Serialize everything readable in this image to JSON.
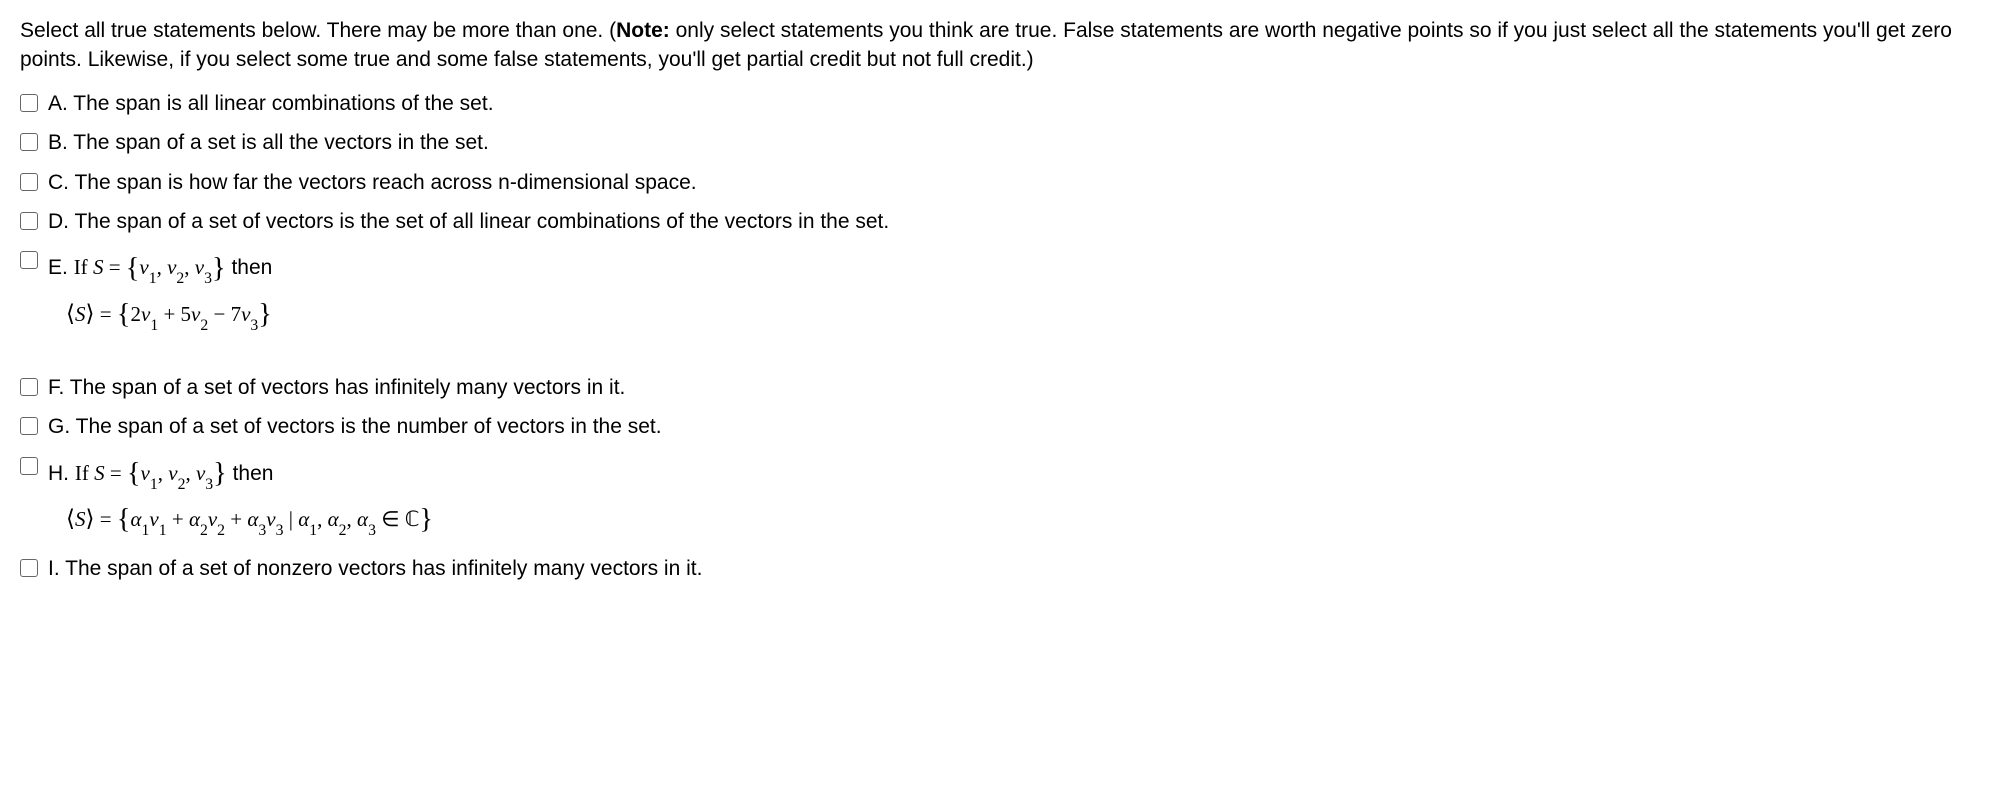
{
  "instructions": {
    "p1a": "Select all true statements below.  There may be more than one.  (",
    "noteLabel": "Note:",
    "p1b": " only select statements you think are true. False statements are worth negative points so if you just select all the statements you'll get zero points. Likewise, if you select some true and some false statements, you'll get partial credit but not full credit.)"
  },
  "options": {
    "A": {
      "label": "A. The span is all linear combinations of the set."
    },
    "B": {
      "label": "B. The span of a set is all the vectors in the set."
    },
    "C": {
      "label": "C. The span is how far the vectors reach across n-dimensional space."
    },
    "D": {
      "label": "D. The span of a set of vectors is the set of all linear combinations of the vectors in the set."
    },
    "E": {
      "prefix": "E. ",
      "if": "If  ",
      "S": "S",
      "eq": " = ",
      "then": "  then",
      "set_open": "{",
      "v": "v",
      "s1": "1",
      "s2": "2",
      "s3": "3",
      "comma": ", ",
      "set_close": "}",
      "span_open": "⟨",
      "span_close": "⟩",
      "c2": "2",
      "c5": "5",
      "c7": "7",
      "plus": " + ",
      "minus": " − "
    },
    "F": {
      "label": "F.  The span of a set of vectors has infinitely many vectors in it."
    },
    "G": {
      "label": "G. The span of a set of vectors is the number of vectors in the set."
    },
    "H": {
      "prefix": "H. ",
      "if": "If  ",
      "S": "S",
      "eq": " = ",
      "then": "  then",
      "set_open": "{",
      "v": "v",
      "alpha": "α",
      "s1": "1",
      "s2": "2",
      "s3": "3",
      "comma": ", ",
      "set_close": "}",
      "span_open": "⟨",
      "span_close": "⟩",
      "plus": " + ",
      "bar": " | ",
      "in": " ∈ ",
      "C": "ℂ"
    },
    "I": {
      "label": "I.  The span of a set of nonzero vectors has infinitely many vectors in it."
    }
  }
}
